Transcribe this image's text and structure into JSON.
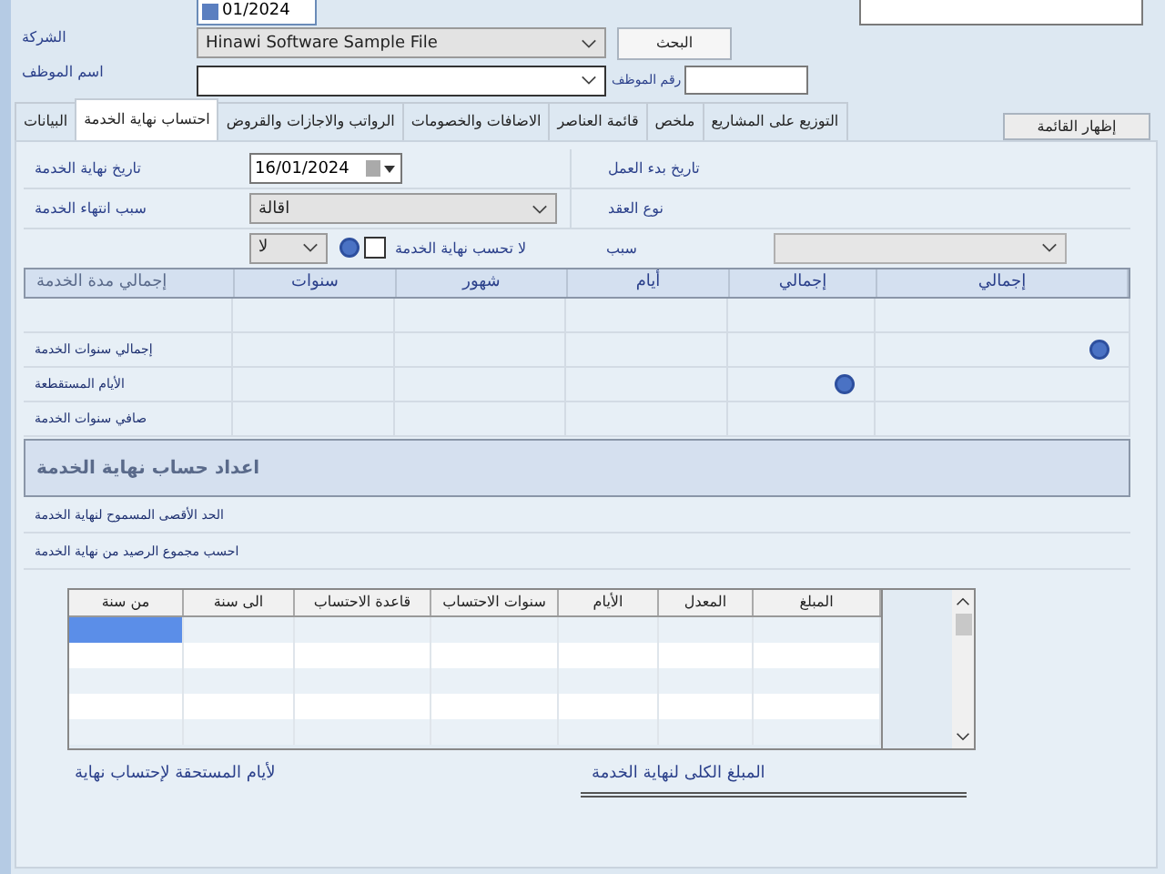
{
  "header": {
    "date_field": {
      "value": "01/2024"
    },
    "company": {
      "label": "الشركة",
      "value": "Hinawi Software Sample File"
    },
    "search_button": "البحث",
    "employee_name": {
      "label": "اسم الموظف"
    },
    "employee_number": {
      "label": "رقم الموظف"
    }
  },
  "tabs": [
    {
      "label": "التوزيع على المشاريع",
      "selected": false
    },
    {
      "label": "ملخص",
      "selected": false
    },
    {
      "label": "قائمة العناصر",
      "selected": false
    },
    {
      "label": "الاضافات والخصومات",
      "selected": false
    },
    {
      "label": "الرواتب والاجازات والقروض",
      "selected": false
    },
    {
      "label": "احتساب نهاية الخدمة",
      "selected": true
    },
    {
      "label": "البيانات",
      "selected": false
    }
  ],
  "show_list_button": "إظهار القائمة",
  "form": {
    "end_date": {
      "label": "تاريخ نهاية الخدمة",
      "value": "16/01/2024"
    },
    "start_date": {
      "label": "تاريخ بدء العمل"
    },
    "reason": {
      "label": "سبب انتهاء الخدمة",
      "value": "اقالة"
    },
    "contract_type": {
      "label": "نوع العقد"
    },
    "exclude": {
      "value": "لا",
      "checked": false,
      "label": "لا تحسب نهاية الخدمة"
    },
    "cause": {
      "label": "سبب",
      "disabled": true
    }
  },
  "summary_table": {
    "columns": [
      "إجمالي",
      "إجمالي",
      "أيام",
      "شهور",
      "سنوات",
      "إجمالي مدة الخدمة"
    ],
    "rows": [
      {
        "help_icons": [
          false,
          false,
          false,
          false,
          false
        ]
      },
      {
        "label": "إجمالي سنوات الخدمة",
        "help_icons": [
          true,
          false,
          false,
          false,
          false
        ]
      },
      {
        "label": "الأيام المستقطعة",
        "help_icons": [
          false,
          true,
          false,
          false,
          false
        ]
      },
      {
        "label": "صافي سنوات الخدمة",
        "help_icons": [
          false,
          false,
          false,
          false,
          false
        ]
      }
    ]
  },
  "settings": {
    "title": "اعداد حساب نهاية الخدمة",
    "items": [
      "الحد الأقصى المسموح لنهاية الخدمة",
      "احسب مجموع الرصيد من نهاية الخدمة"
    ]
  },
  "grid": {
    "columns": [
      "المبلغ",
      "المعدل",
      "الأيام",
      "سنوات الاحتساب",
      "قاعدة الاحتساب",
      "الى سنة",
      "من سنة"
    ],
    "rows": [
      {
        "selected": true
      },
      {
        "selected": false
      },
      {
        "selected": false
      },
      {
        "selected": false
      },
      {
        "selected": false
      }
    ]
  },
  "totals": {
    "days_label": "لأيام المستحقة لإحتساب نهاية",
    "amount_label": "المبلغ الكلى لنهاية الخدمة"
  }
}
